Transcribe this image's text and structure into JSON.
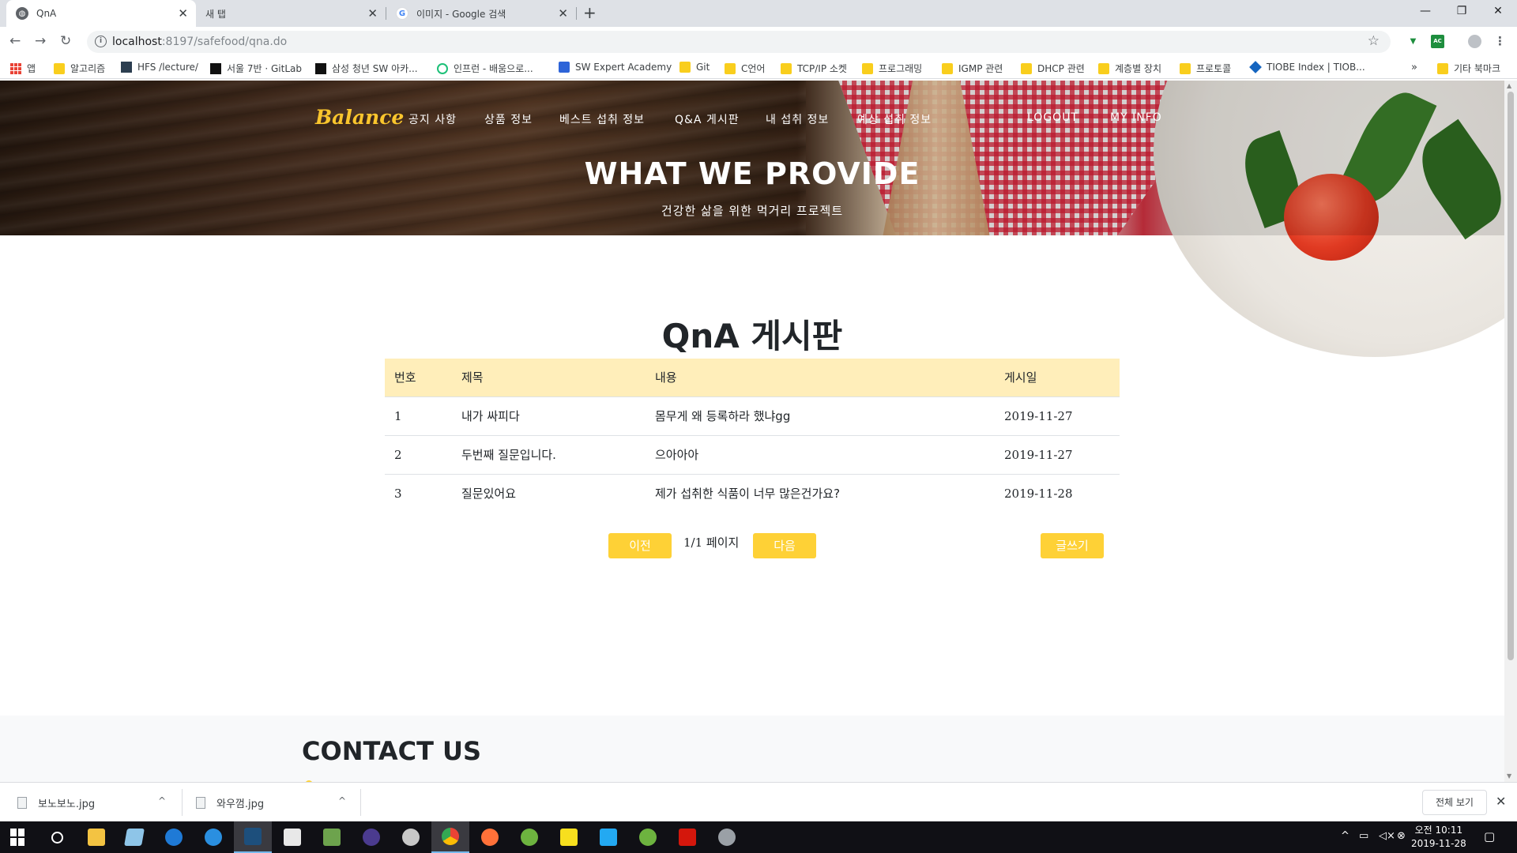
{
  "browser": {
    "tabs": [
      {
        "title": "QnA",
        "active": true
      },
      {
        "title": "새 탭",
        "active": false
      },
      {
        "title": "이미지 - Google 검색",
        "active": false
      }
    ],
    "new_tab_symbol": "+",
    "window_controls": {
      "minimize": "—",
      "restore": "❐",
      "close": "✕"
    },
    "url_host": "localhost",
    "url_path": ":8197/safefood/qna.do",
    "bookmarks": [
      {
        "label": "앱",
        "icon": "apps-grid-icon"
      },
      {
        "label": "알고리즘",
        "icon": "folder-icon"
      },
      {
        "label": "HFS /lecture/",
        "icon": "hfs-icon"
      },
      {
        "label": "서울 7반 · GitLab",
        "icon": "gitlab-icon"
      },
      {
        "label": "삼성 청년 SW 아카...",
        "icon": "ssafy-icon"
      },
      {
        "label": "인프런 - 배움으로...",
        "icon": "inflearn-icon"
      },
      {
        "label": "SW Expert Academy",
        "icon": "swea-icon"
      },
      {
        "label": "Git",
        "icon": "folder-icon"
      },
      {
        "label": "C언어",
        "icon": "folder-icon"
      },
      {
        "label": "TCP/IP 소켓",
        "icon": "folder-icon"
      },
      {
        "label": "프로그래밍",
        "icon": "folder-icon"
      },
      {
        "label": "IGMP 관련",
        "icon": "folder-icon"
      },
      {
        "label": "DHCP 관련",
        "icon": "folder-icon"
      },
      {
        "label": "계층별 장치",
        "icon": "folder-icon"
      },
      {
        "label": "프로토콜",
        "icon": "folder-icon"
      },
      {
        "label": "TIOBE Index | TIOB...",
        "icon": "tiobe-icon"
      }
    ],
    "bookmarks_overflow": "»",
    "other_bookmarks": "기타 북마크"
  },
  "site": {
    "brand": "Balance",
    "nav": [
      "공지 사항",
      "상품 정보",
      "베스트 섭취 정보",
      "Q&A 게시판",
      "내 섭취 정보",
      "예상 섭취 정보",
      "LOGOUT",
      "MY INFO"
    ],
    "hero_title": "WHAT WE PROVIDE",
    "hero_subtitle": "건강한 삶을 위한 먹거리 프로젝트"
  },
  "board": {
    "title": "QnA 게시판",
    "columns": [
      "번호",
      "제목",
      "내용",
      "게시일"
    ],
    "rows": [
      [
        "1",
        "내가 싸피다",
        "몸무게 왜 등록하라 했냐gg",
        "2019-11-27"
      ],
      [
        "2",
        "두번째 질문입니다.",
        "으아아아",
        "2019-11-27"
      ],
      [
        "3",
        "질문있어요",
        "제가 섭취한 식품이 너무 많은건가요?",
        "2019-11-28"
      ]
    ],
    "prev_label": "이전",
    "page_info": "1/1 페이지",
    "next_label": "다음",
    "write_label": "글쓰기"
  },
  "contact": {
    "title": "CONTACT US"
  },
  "downloads": {
    "files": [
      "보노보노.jpg",
      "와우껌.jpg"
    ],
    "show_all": "전체 보기",
    "close": "✕"
  },
  "taskbar": {
    "time": "오전 10:11",
    "date": "2019-11-28"
  },
  "colors": {
    "accent": "#fed136",
    "table_header": "#ffeeba",
    "brand": "#f9c52d"
  }
}
